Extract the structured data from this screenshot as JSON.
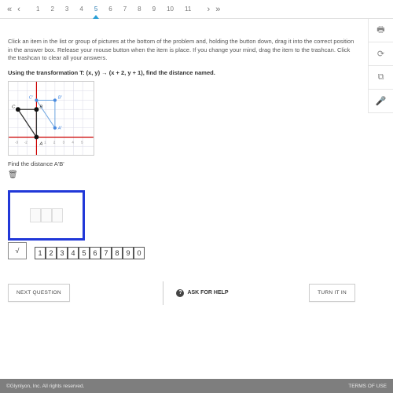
{
  "pager": {
    "nums": [
      "1",
      "2",
      "3",
      "4",
      "5",
      "6",
      "7",
      "8",
      "9",
      "10",
      "11"
    ],
    "active": 4
  },
  "instructions": "Click an item in the list or group of pictures at the bottom of the problem and, holding the button down, drag it into the correct position in the answer box. Release your mouse button when the item is place. If you change your mind, drag the item to the trashcan. Click the trashcan to clear all your answers.",
  "equation": "Using the transformation T: (x, y) → (x + 2, y + 1), find the distance named.",
  "find": "Find the distance A'B'",
  "tiles": [
    "1",
    "2",
    "3",
    "4",
    "5",
    "6",
    "7",
    "8",
    "9",
    "0"
  ],
  "sqrt": "√",
  "buttons": {
    "next": "NEXT QUESTION",
    "ask": "ASK FOR HELP",
    "turnin": "TURN IT IN"
  },
  "footer": {
    "left": "©Glynlyon, Inc. All rights reserved.",
    "right": "TERMS OF USE"
  },
  "chart_data": {
    "type": "scatter",
    "title": "",
    "xlabel": "",
    "ylabel": "",
    "xlim": [
      -3,
      5
    ],
    "ylim": [
      -2,
      5
    ],
    "points": [
      {
        "name": "A",
        "x": 0,
        "y": 0
      },
      {
        "name": "B",
        "x": 0,
        "y": 3
      },
      {
        "name": "C",
        "x": -2,
        "y": 3
      },
      {
        "name": "A'",
        "x": 2,
        "y": 1
      },
      {
        "name": "B'",
        "x": 2,
        "y": 4
      },
      {
        "name": "C'",
        "x": 0,
        "y": 4
      }
    ],
    "grid": true
  }
}
